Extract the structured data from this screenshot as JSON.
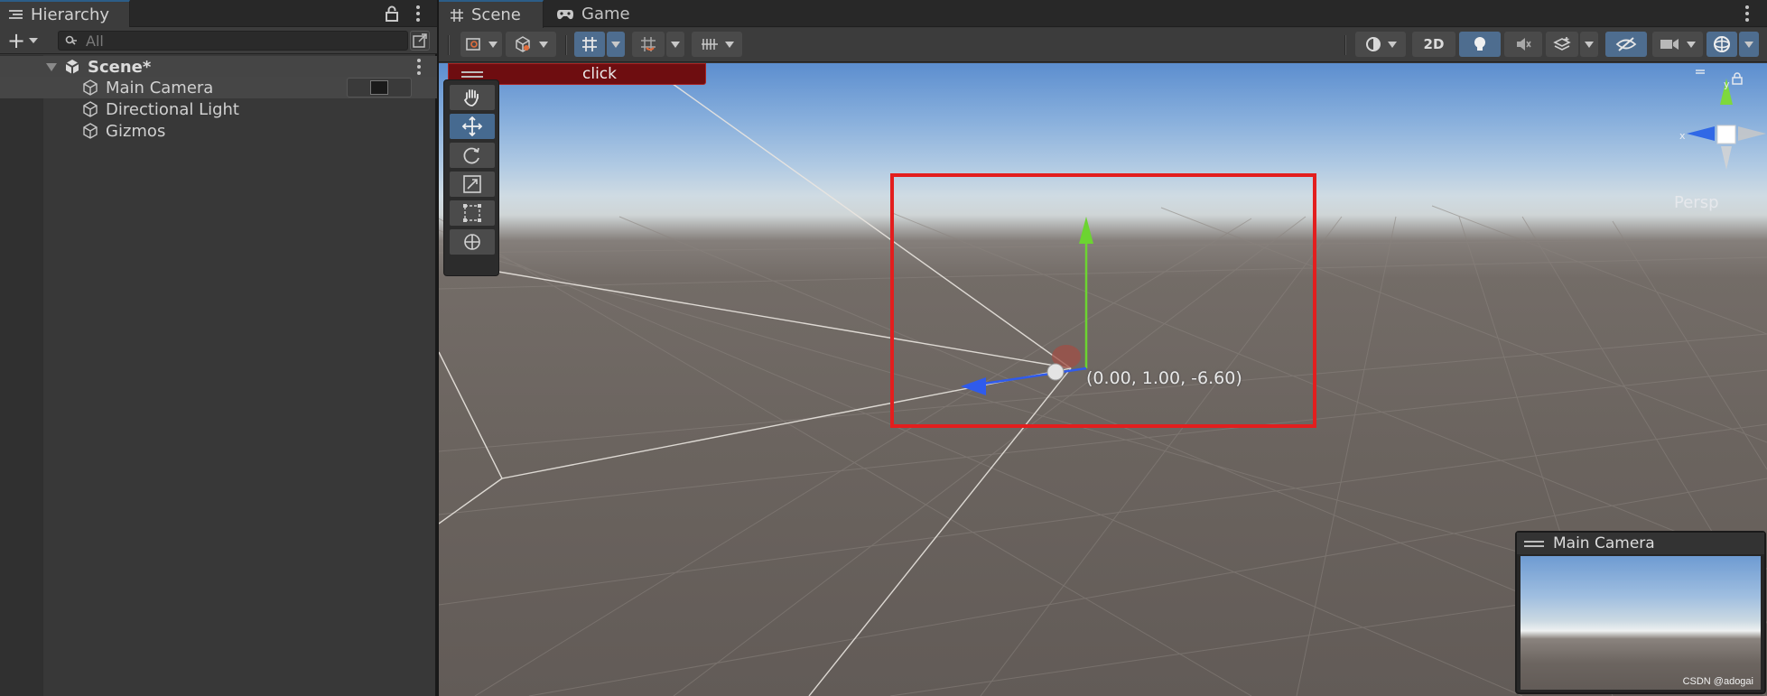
{
  "hierarchy": {
    "tab_title": "Hierarchy",
    "add_label": "+",
    "search_placeholder": "All",
    "items": [
      {
        "label": "Scene*"
      },
      {
        "label": "Main Camera"
      },
      {
        "label": "Directional Light"
      },
      {
        "label": "Gizmos"
      }
    ]
  },
  "scene_view": {
    "tabs": [
      {
        "label": "Scene",
        "icon": "grid-icon"
      },
      {
        "label": "Game",
        "icon": "gamepad-icon"
      }
    ],
    "toolbar": {
      "mode_2d_label": "2D"
    },
    "click_label": "click",
    "coordinate_readout": "(0.00, 1.00, -6.60)",
    "projection_label": "Persp",
    "gizmo_axes": {
      "y": "y",
      "x": "x"
    },
    "camera_preview_title": "Main Camera",
    "watermark": "CSDN @adogai",
    "colors": {
      "selection_box": "#e31e1e",
      "axis_y": "#6cd431",
      "axis_z": "#2f5bec",
      "accent_active": "#4e6d8f"
    }
  }
}
